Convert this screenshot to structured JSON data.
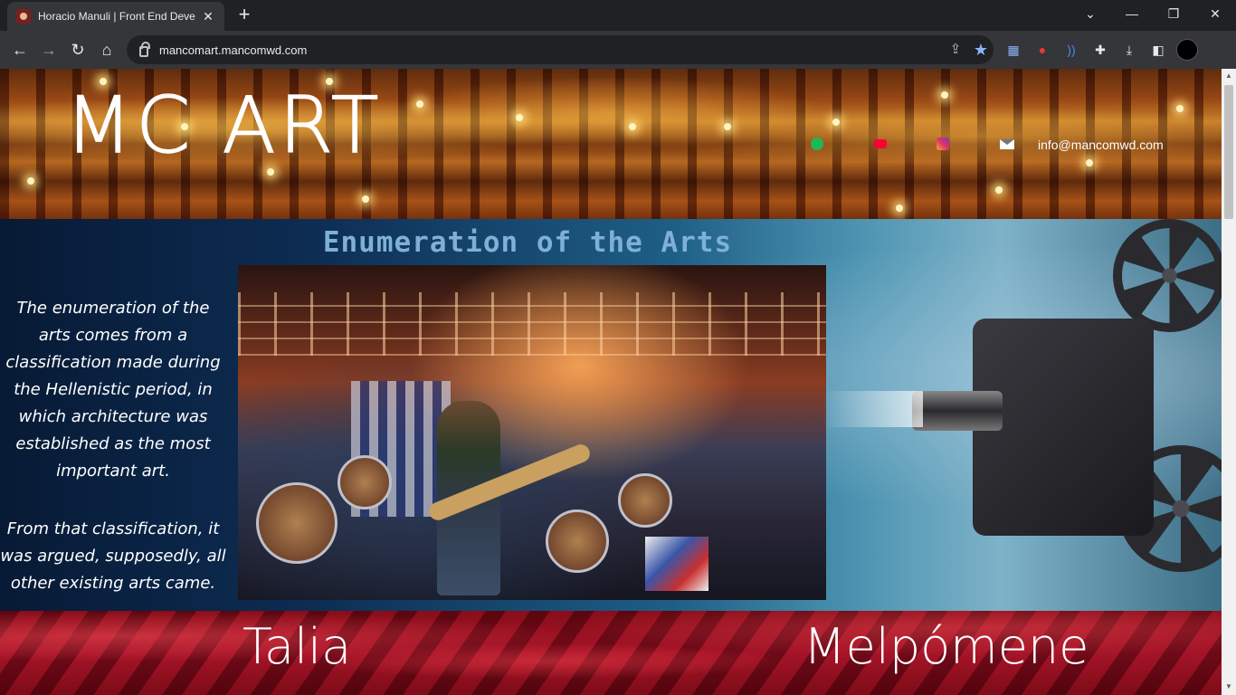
{
  "browser": {
    "tab_title": "Horacio Manuli | Front End Deve",
    "url": "mancomart.mancomwd.com",
    "new_tab": "+",
    "tab_close": "✕"
  },
  "site": {
    "logo": "MC ART",
    "email": "info@mancomwd.com",
    "social_icons": [
      "spotify-icon",
      "youtube-icon",
      "instagram-icon",
      "mail-icon"
    ]
  },
  "arts": {
    "title": "Enumeration of the Arts",
    "paragraph1": "The enumeration of the arts comes from a classification made during the Hellenistic period, in which architecture was established as the most important art.",
    "paragraph2": "From that classification, it was argued, supposedly, all other existing arts came."
  },
  "muses": {
    "left": "Talia",
    "right": "Melpómene"
  },
  "colors": {
    "title_blue": "#7fb0d6",
    "velvet_red": "#a3142a",
    "bookmark_star": "#8ab4f8"
  }
}
